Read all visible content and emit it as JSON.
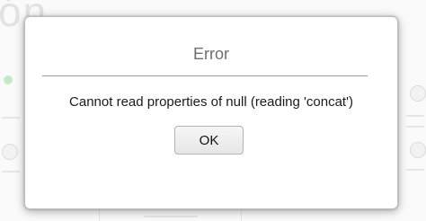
{
  "background": {
    "heading_fragment": "ón"
  },
  "dialog": {
    "title": "Error",
    "message": "Cannot read properties of null (reading 'concat')",
    "ok_label": "OK"
  }
}
